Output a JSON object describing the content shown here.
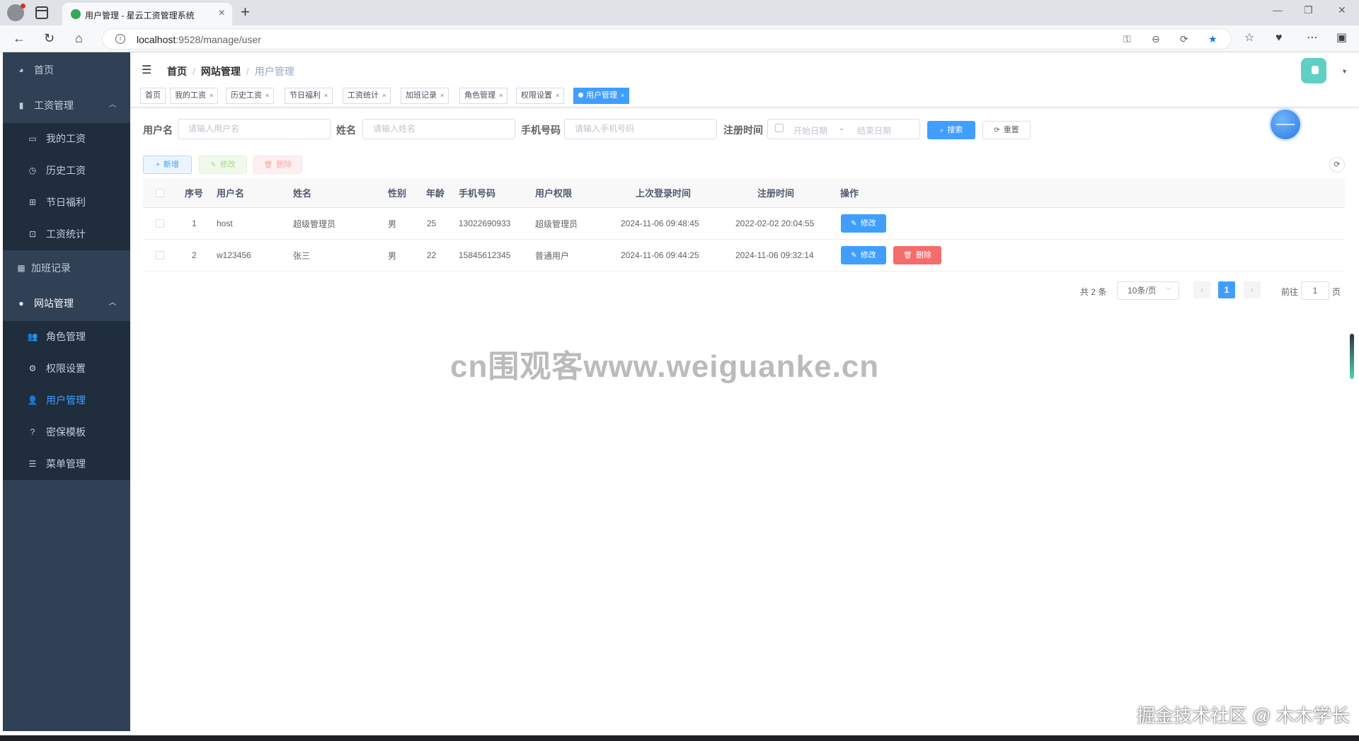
{
  "browser": {
    "tab_title": "用户管理 - 星云工资管理系统",
    "url_host": "localhost",
    "url_path": ":9528/manage/user"
  },
  "sidebar": {
    "items": [
      {
        "label": "首页",
        "icon": "dashboard-icon"
      },
      {
        "label": "工资管理",
        "icon": "bar-chart-icon",
        "children": [
          {
            "label": "我的工资",
            "icon": "wallet-icon"
          },
          {
            "label": "历史工资",
            "icon": "clock-icon"
          },
          {
            "label": "节日福利",
            "icon": "gift-icon"
          },
          {
            "label": "工资统计",
            "icon": "chart-board-icon"
          }
        ]
      },
      {
        "label": "加班记录",
        "icon": "calendar-icon"
      },
      {
        "label": "网站管理",
        "icon": "globe-icon",
        "children": [
          {
            "label": "角色管理",
            "icon": "users-icon"
          },
          {
            "label": "权限设置",
            "icon": "gear-icon"
          },
          {
            "label": "用户管理",
            "icon": "user-icon",
            "active": true
          },
          {
            "label": "密保模板",
            "icon": "question-icon"
          },
          {
            "label": "菜单管理",
            "icon": "list-icon"
          }
        ]
      }
    ]
  },
  "breadcrumb": [
    "首页",
    "网站管理",
    "用户管理"
  ],
  "tags": [
    {
      "label": "首页",
      "closable": false
    },
    {
      "label": "我的工资",
      "closable": true
    },
    {
      "label": "历史工资",
      "closable": true
    },
    {
      "label": "节日福利",
      "closable": true
    },
    {
      "label": "工资统计",
      "closable": true
    },
    {
      "label": "加班记录",
      "closable": true
    },
    {
      "label": "角色管理",
      "closable": true
    },
    {
      "label": "权限设置",
      "closable": true
    },
    {
      "label": "用户管理",
      "closable": true,
      "active": true
    }
  ],
  "close_glyph": "×",
  "search": {
    "username_label": "用户名",
    "username_placeholder": "请输入用户名",
    "name_label": "姓名",
    "name_placeholder": "请输入姓名",
    "phone_label": "手机号码",
    "phone_placeholder": "请输入手机号码",
    "regtime_label": "注册时间",
    "start_placeholder": "开始日期",
    "range_separator": "-",
    "end_placeholder": "结束日期",
    "search_button": "搜索",
    "reset_button": "重置"
  },
  "toolbar": {
    "add_button": "新增",
    "edit_button": "修改",
    "delete_button": "删除"
  },
  "table": {
    "columns": [
      "序号",
      "用户名",
      "姓名",
      "性别",
      "年龄",
      "手机号码",
      "用户权限",
      "上次登录时间",
      "注册时间",
      "操作"
    ],
    "rows": [
      {
        "index": "1",
        "username": "host",
        "name": "超级管理员",
        "gender": "男",
        "age": "25",
        "phone": "13022690933",
        "role": "超级管理员",
        "last_login": "2024-11-06 09:48:45",
        "register": "2022-02-02 20:04:55",
        "can_delete": false
      },
      {
        "index": "2",
        "username": "w123456",
        "name": "张三",
        "gender": "男",
        "age": "22",
        "phone": "15845612345",
        "role": "普通用户",
        "last_login": "2024-11-06 09:44:25",
        "register": "2024-11-06 09:32:14",
        "can_delete": true
      }
    ],
    "row_edit_label": "修改",
    "row_delete_label": "删除"
  },
  "pagination": {
    "total_text": "共 2 条",
    "page_size": "10条/页",
    "current_page": "1",
    "goto_label": "前往",
    "goto_value": "1",
    "page_unit": "页"
  },
  "watermarks": {
    "center": "cn围观客www.weiguanke.cn",
    "corner": "掘金技术社区 @ 木木学长"
  },
  "colors": {
    "sidebar_bg": "#304156",
    "submenu_bg": "#1f2d3d",
    "primary": "#409eff",
    "danger": "#f56c6c"
  }
}
